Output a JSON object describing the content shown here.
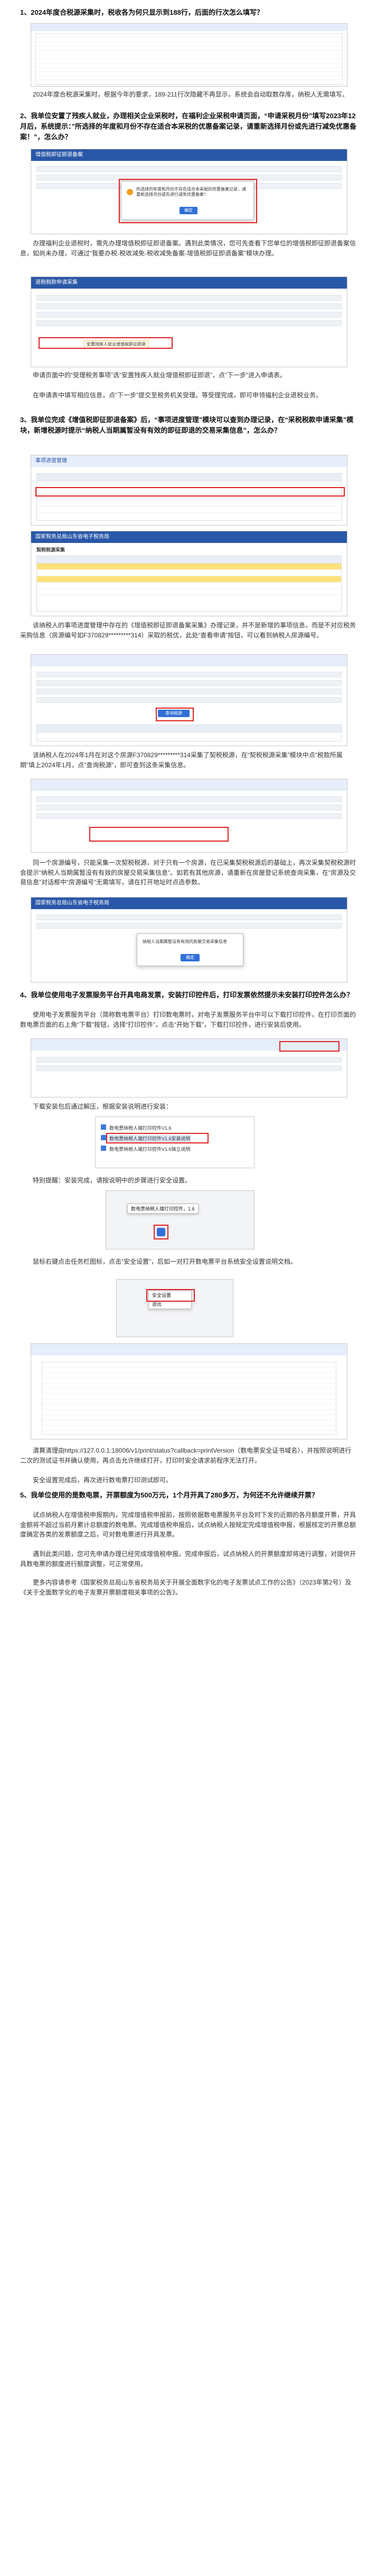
{
  "q1": {
    "title": "1、2024年度合税源采集时，税收各为何只显示到188行，后面的行次怎么填写？",
    "answer": "2024年度合税源采集时，根据今年的要求，189-211行次隐藏不再显示，系统会自动取数存库，纳税人无需填写。"
  },
  "q2": {
    "title": "2、我单位安置了残疾人就业，办理相关企业采税时，在福利企业采税申请页面，“申请采税月份”填写2023年12月后，系统提示：”所选择的年度和月份不存在适合本采税的优惠备案记录，请重新选择月份或先进行减免优惠备案！”，怎么办？",
    "answer1": "办理福利企业退税时，需先办理增值税即征即退备案。遇到此类情况，您可先查看下您单位的增值税即征即退备案信息，如尚未办理，可通过“我要办税-税收减免-税收减免备案-增值税即征即退备案”模块办理。",
    "answer2": "申请页面中的“受理税务事项”选“安置残疾人就业增值税即征即退”，点“下一步”进入申请表。",
    "answer3": "在申请表中填写相应信息，点“下一步”提交至税务机关受理。等受理完成，即可申领福利企业退税业务。"
  },
  "q3": {
    "title": "3、我单位完成《增值税即征即退备案》后，“事项进度管理”模块可以查到办理记录，在“采税税款申请采集”模块，新增税源时提示“纳税人当期属暂没有有效的即征即退的交易采集信息”，怎么办？",
    "answer1": "该纳税人的事项进度管理中存在的《增值税即征即退备案采集》办理记录，并不是新增的事项信息，而是不对应税务采购信息（房源编号如F370829*********314）采取的税优，此处“查看申请”按钮，可以看到纳税人房源编号。",
    "answer2": "该纳税人在2024年1月在对这个房源F370829*********314采集了契税税源，在“契税税源采集”模块中点“税款所属期”填上2024年1月，点“查询税源”，即可查到这条采集信息。",
    "answer3": "同一个房源编号，只能采集一次契税税源，对于只有一个房源，在已采集契税税源后的基础上，再次采集契税税源时会提示“纳税人当期属暂没有有效的房屋交易采集信息”。如若有其他房源，请重新在房屋登记系统查询采集，在“房源及交易信息”对话框中“房源编号”无需填写，请在打开地址时点选参数。"
  },
  "q4": {
    "title": "4、我单位使用电子发票服务平台开具电商发票，安装打印控件后，打印发票依然提示未安装打印控件怎么办？",
    "answer1": "使用电子发票服务平台（简称数电票平台）打印数电票时，对电子发票服务平台中可以下载打印控件，在打印页面的数电票页面的右上角“下载”按钮，选择“打印控件”，点击“开始下载”，下载打印控件，进行安装后使用。",
    "answer2": "下载安装包后通过解压，根据安装说明进行安装：",
    "files": [
      "数电票纳税人端打印控件V1.6",
      "数电票纳税人端打印控件V1.6安装说明",
      "数电票纳税人端打印控件V1.6独立说明"
    ],
    "note": "特别提醒：安装完成，请按说明中的步骤进行安全设置。",
    "tray_label": "数电票纳税人端打印控件，1.6",
    "answer3": "鼠标右键点击任务栏图标，点击“安全设置”，后如一对打开数电票平台系统安全设置说明文档。",
    "menu_items": [
      "安全设置",
      "退出"
    ],
    "answer4": "清算清理由https://127.0.0.1:18006/v1/print/status?callback=printVersion（数电票安全证书域名），并按照说明进行二次的测试证书并确认使用，再点击允许继续打开，打印时安全请求前程序无法打开。",
    "answer5": "安全设置完成后，再次进行数电票打印测试即可。"
  },
  "q5": {
    "title": "5、我单位使用的是数电票，开票额度为500万元，1个月开具了280多万，为何还不允许继续开票？",
    "answer1": "试点纳税人在增值税申报期内，完成增值税申报前，按照依据数电票服务平台及时下发的近期的各月额度开票，开具金额将不超过当前月累计总额度的数电票。完成增值税申报后，试点纳税人按规定完成增值税申报，根据核定的开票总额度确定各类的发票额度之后，可对数电票进行开具发票。",
    "answer2": "遇到此类问题，您可先申请办理已经完成增值税申报。完成申报后，试点纳税人的开票额度即将进行调整，对提供开具数电票的额度进行额度调整，可正常使用。",
    "answer3": "更多内容请参考《国家税务总局山东省税务局关于开展全面数字化的电子发票试点工作的公告》（2023年第2号）及《关于全面数字化的电子发票开票额度相关事项的公告》。"
  },
  "screens": {
    "s1_bar": "增值税即征即退备案",
    "s1_modal": "所选择的年度和月份不存在适合本采税的优惠备案记录，请重新选择月份或先进行减免优惠备案！",
    "s1_ok": "确定",
    "s2_bar": "退税税款申请采集",
    "s2_field": "安置残疾人就业增值税即征即退",
    "s3_bar": "事项进度管理",
    "s3_btn": "查看申请",
    "s4_bar": "国家税务总局山东省电子税务局",
    "s4_title": "契税税源采集",
    "s5_btn": "查询税源",
    "s6_bar": "国家税务总局山东省电子税务局",
    "s6_modal": "纳税人当期属暂没有有效的房屋交易采集信息",
    "s6_ok": "确定"
  },
  "colors": {
    "accent": "#2a58a8",
    "highlight": "#e02020"
  }
}
